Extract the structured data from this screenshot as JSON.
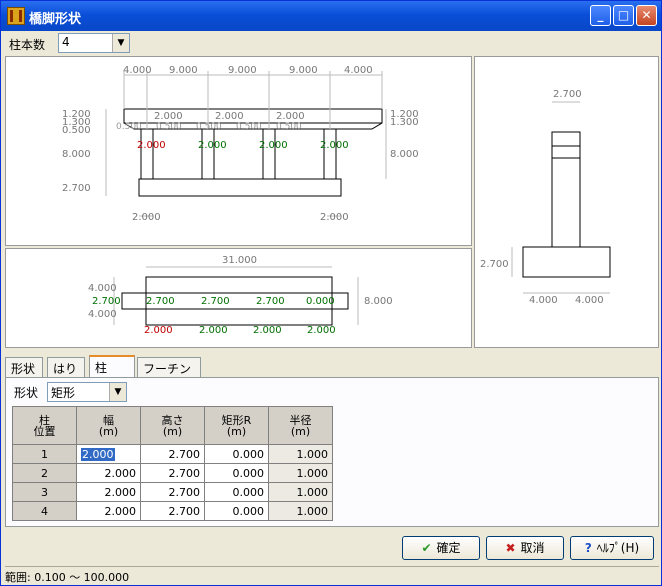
{
  "window": {
    "title": "橋脚形状"
  },
  "toolbar": {
    "column_count_label": "柱本数",
    "column_count_value": "4"
  },
  "elevation": {
    "top_dims": [
      "4.000",
      "9.000",
      "9.000",
      "9.000",
      "4.000"
    ],
    "left_dims": [
      "1.200",
      "1.300",
      "0.500",
      "8.000",
      "2.700"
    ],
    "right_dims": [
      "1.200",
      "1.300",
      "8.000"
    ],
    "beam_dims": [
      "2.000",
      "2.000",
      "2.000",
      "0.500",
      "0.500",
      "0.500",
      "0.500",
      "0.500"
    ],
    "col_widths": [
      "2.000",
      "2.000",
      "2.000",
      "2.000"
    ],
    "footing_dims": [
      "2.000",
      "2.000"
    ]
  },
  "plan": {
    "length": "31.000",
    "left_dims": [
      "4.000",
      "2.700",
      "4.000"
    ],
    "right_dim": "8.000",
    "col_depths": [
      "2.700",
      "2.700",
      "2.700",
      "0.000"
    ],
    "col_widths": [
      "2.000",
      "2.000",
      "2.000",
      "2.000"
    ]
  },
  "side": {
    "top": "2.700",
    "left": "2.700",
    "bottom": [
      "4.000",
      "4.000"
    ]
  },
  "tabs": [
    "形状",
    "はり",
    "柱",
    "フーチング"
  ],
  "shape_label": "形状",
  "shape_value": "矩形",
  "table": {
    "headers": [
      [
        "柱",
        "位置"
      ],
      [
        "幅",
        "(m)"
      ],
      [
        "高さ",
        "(m)"
      ],
      [
        "矩形R",
        "(m)"
      ],
      [
        "半径",
        "(m)"
      ]
    ],
    "rows": [
      [
        "1",
        "2.000",
        "2.700",
        "0.000",
        "1.000"
      ],
      [
        "2",
        "2.000",
        "2.700",
        "0.000",
        "1.000"
      ],
      [
        "3",
        "2.000",
        "2.700",
        "0.000",
        "1.000"
      ],
      [
        "4",
        "2.000",
        "2.700",
        "0.000",
        "1.000"
      ]
    ]
  },
  "buttons": {
    "ok": "確定",
    "cancel": "取消",
    "help": "ﾍﾙﾌﾟ(H)"
  },
  "status": "範囲: 0.100 〜 100.000"
}
